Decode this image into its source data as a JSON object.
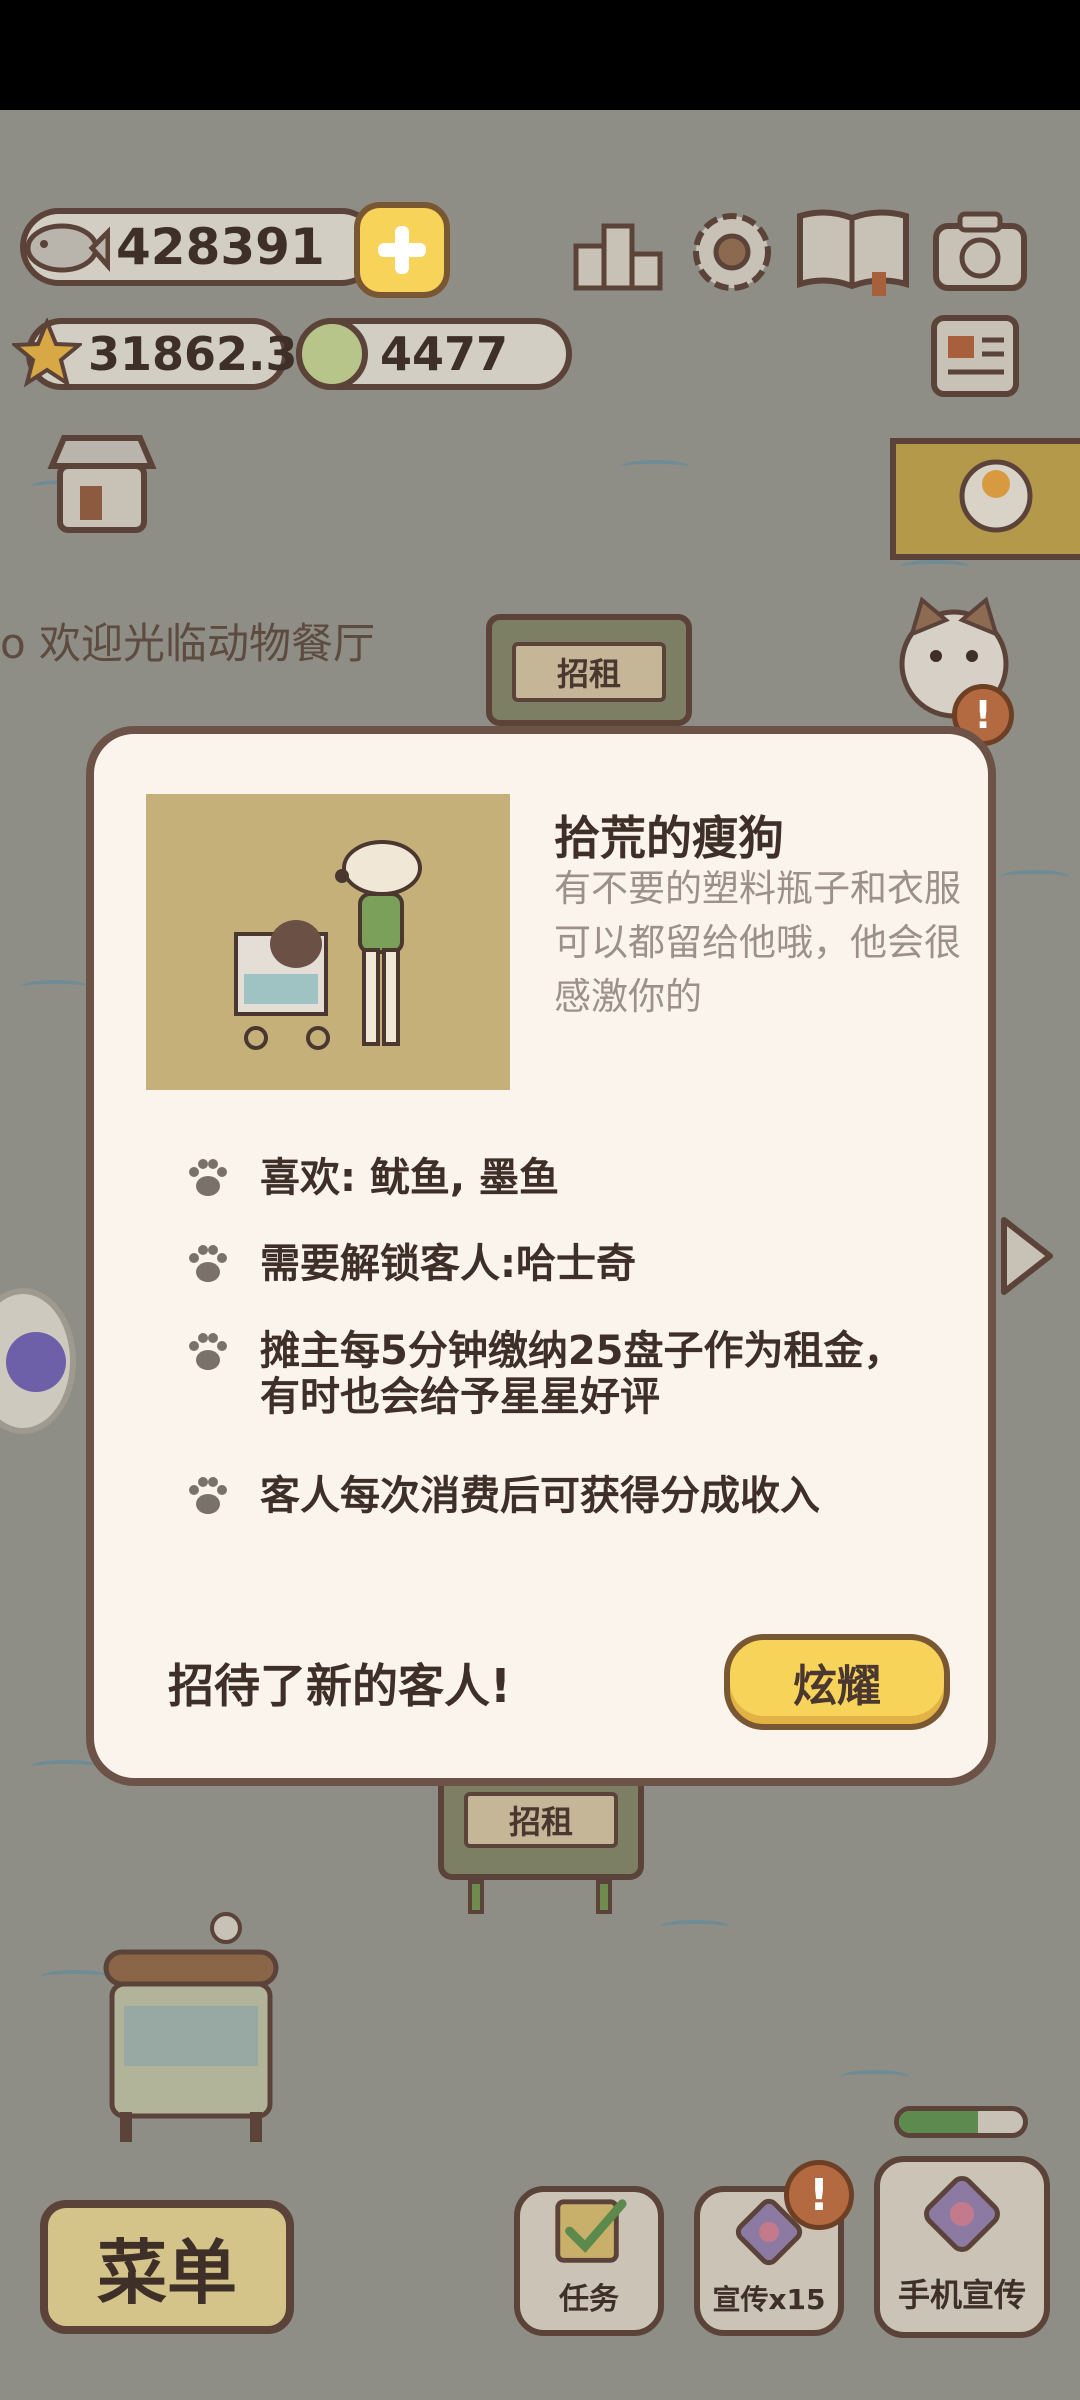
{
  "resources": {
    "fish_count": "428391",
    "star_count": "31862.3",
    "token_count": "4477"
  },
  "scene": {
    "marquee_text": "o 欢迎光临动物餐厅",
    "rent_sign_top": "招租",
    "rent_sign_bottom": "招租"
  },
  "modal": {
    "character_name": "拾荒的瘦狗",
    "character_desc": "有不要的塑料瓶子和衣服可以都留给他哦，他会很感激你的",
    "attributes": [
      "喜欢: 鱿鱼, 墨鱼",
      "需要解锁客人:哈士奇",
      "摊主每5分钟缴纳25盘子作为租金，\n有时也会给予星星好评",
      "客人每次消费后可获得分成收入"
    ],
    "new_guest_text": "招待了新的客人!",
    "show_off_label": "炫耀"
  },
  "bottom_bar": {
    "menu_label": "菜单",
    "tasks_label": "任务",
    "promo_label": "宣传x15",
    "phone_promo_label": "手机宣传",
    "promo_badge": "!"
  },
  "colors": {
    "accent_yellow": "#f8d35a",
    "outline_brown": "#5b4339",
    "modal_bg": "#fbf4ec",
    "portrait_bg": "#c4b078"
  }
}
